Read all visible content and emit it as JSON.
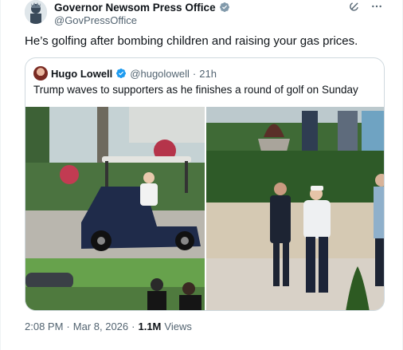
{
  "post": {
    "author_name": "Governor Newsom Press Office",
    "author_handle": "@GovPressOffice",
    "text": "He’s golfing after bombing children and raising your gas prices.",
    "icons": {
      "verified": "verified-badge-icon",
      "grok": "grok-icon",
      "more": "more-icon"
    }
  },
  "quote": {
    "author_name": "Hugo Lowell",
    "author_handle": "@hugolowell",
    "separator": "·",
    "time": "21h",
    "text": "Trump waves to supporters as he finishes a round of golf on Sunday"
  },
  "footer": {
    "time": "2:08 PM",
    "separator": "·",
    "date": "Mar 8, 2026",
    "separator2": "·",
    "views_count": "1.1M",
    "views_label": "Views"
  },
  "colors": {
    "verified": "#1d9bf0",
    "text": "#0f1419",
    "secondary": "#536471",
    "border": "#cfd9de"
  }
}
